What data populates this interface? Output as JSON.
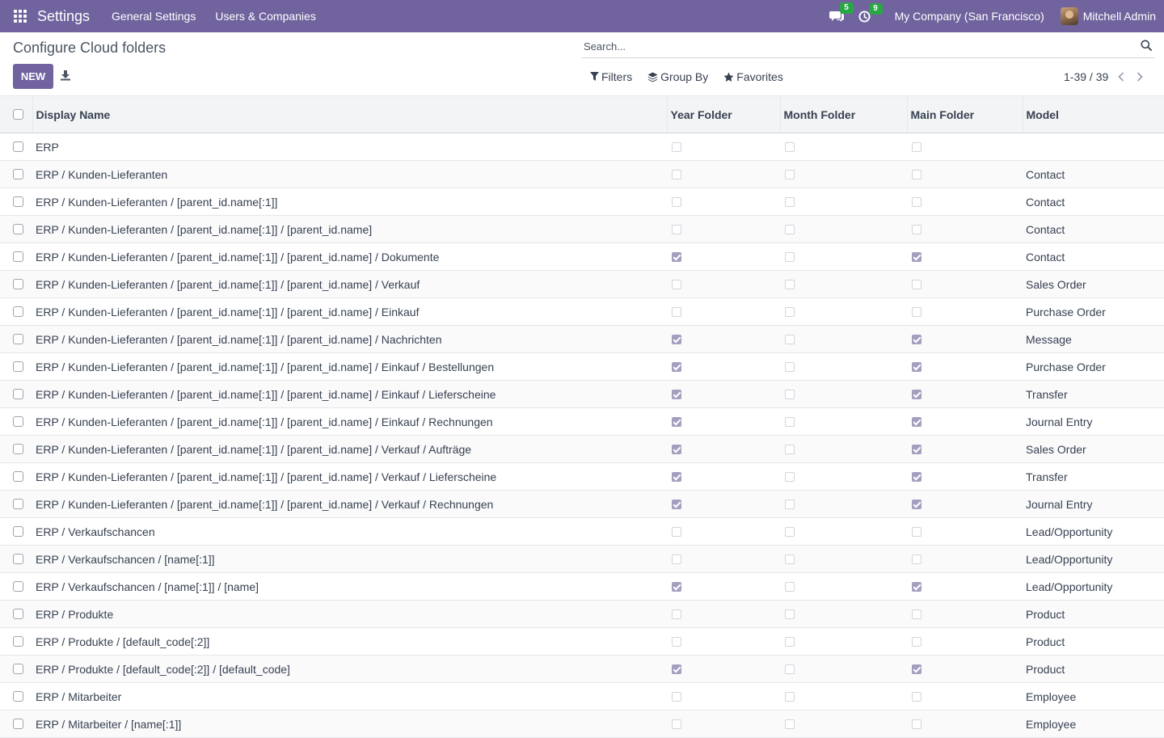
{
  "navbar": {
    "app_name": "Settings",
    "menus": [
      "General Settings",
      "Users & Companies"
    ],
    "messages_count": "5",
    "activities_count": "9",
    "company": "My Company (San Francisco)",
    "user": "Mitchell Admin",
    "bg_color": "#71639e"
  },
  "control_panel": {
    "title": "Configure Cloud folders",
    "new_label": "NEW",
    "search_placeholder": "Search...",
    "filters_label": "Filters",
    "group_by_label": "Group By",
    "favorites_label": "Favorites",
    "pager_value": "1-39 / 39"
  },
  "table": {
    "columns": {
      "display_name": "Display Name",
      "year_folder": "Year Folder",
      "month_folder": "Month Folder",
      "main_folder": "Main Folder",
      "model": "Model"
    },
    "rows": [
      {
        "name": "ERP",
        "year": false,
        "month": false,
        "main": false,
        "model": ""
      },
      {
        "name": "ERP / Kunden-Lieferanten",
        "year": false,
        "month": false,
        "main": false,
        "model": "Contact"
      },
      {
        "name": "ERP / Kunden-Lieferanten / [parent_id.name[:1]]",
        "year": false,
        "month": false,
        "main": false,
        "model": "Contact"
      },
      {
        "name": "ERP / Kunden-Lieferanten / [parent_id.name[:1]] / [parent_id.name]",
        "year": false,
        "month": false,
        "main": false,
        "model": "Contact"
      },
      {
        "name": "ERP / Kunden-Lieferanten / [parent_id.name[:1]] / [parent_id.name] / Dokumente",
        "year": true,
        "month": false,
        "main": true,
        "model": "Contact"
      },
      {
        "name": "ERP / Kunden-Lieferanten / [parent_id.name[:1]] / [parent_id.name] / Verkauf",
        "year": false,
        "month": false,
        "main": false,
        "model": "Sales Order"
      },
      {
        "name": "ERP / Kunden-Lieferanten / [parent_id.name[:1]] / [parent_id.name] / Einkauf",
        "year": false,
        "month": false,
        "main": false,
        "model": "Purchase Order"
      },
      {
        "name": "ERP / Kunden-Lieferanten / [parent_id.name[:1]] / [parent_id.name] / Nachrichten",
        "year": true,
        "month": false,
        "main": true,
        "model": "Message"
      },
      {
        "name": "ERP / Kunden-Lieferanten / [parent_id.name[:1]] / [parent_id.name] / Einkauf / Bestellungen",
        "year": true,
        "month": false,
        "main": true,
        "model": "Purchase Order"
      },
      {
        "name": "ERP / Kunden-Lieferanten / [parent_id.name[:1]] / [parent_id.name] / Einkauf / Lieferscheine",
        "year": true,
        "month": false,
        "main": true,
        "model": "Transfer"
      },
      {
        "name": "ERP / Kunden-Lieferanten / [parent_id.name[:1]] / [parent_id.name] / Einkauf / Rechnungen",
        "year": true,
        "month": false,
        "main": true,
        "model": "Journal Entry"
      },
      {
        "name": "ERP / Kunden-Lieferanten / [parent_id.name[:1]] / [parent_id.name] / Verkauf / Aufträge",
        "year": true,
        "month": false,
        "main": true,
        "model": "Sales Order"
      },
      {
        "name": "ERP / Kunden-Lieferanten / [parent_id.name[:1]] / [parent_id.name] / Verkauf / Lieferscheine",
        "year": true,
        "month": false,
        "main": true,
        "model": "Transfer"
      },
      {
        "name": "ERP / Kunden-Lieferanten / [parent_id.name[:1]] / [parent_id.name] / Verkauf / Rechnungen",
        "year": true,
        "month": false,
        "main": true,
        "model": "Journal Entry"
      },
      {
        "name": "ERP / Verkaufschancen",
        "year": false,
        "month": false,
        "main": false,
        "model": "Lead/Opportunity"
      },
      {
        "name": "ERP / Verkaufschancen / [name[:1]]",
        "year": false,
        "month": false,
        "main": false,
        "model": "Lead/Opportunity"
      },
      {
        "name": "ERP / Verkaufschancen / [name[:1]] / [name]",
        "year": true,
        "month": false,
        "main": true,
        "model": "Lead/Opportunity"
      },
      {
        "name": "ERP / Produkte",
        "year": false,
        "month": false,
        "main": false,
        "model": "Product"
      },
      {
        "name": "ERP / Produkte / [default_code[:2]]",
        "year": false,
        "month": false,
        "main": false,
        "model": "Product"
      },
      {
        "name": "ERP / Produkte / [default_code[:2]] / [default_code]",
        "year": true,
        "month": false,
        "main": true,
        "model": "Product"
      },
      {
        "name": "ERP / Mitarbeiter",
        "year": false,
        "month": false,
        "main": false,
        "model": "Employee"
      },
      {
        "name": "ERP / Mitarbeiter / [name[:1]]",
        "year": false,
        "month": false,
        "main": false,
        "model": "Employee"
      }
    ]
  }
}
